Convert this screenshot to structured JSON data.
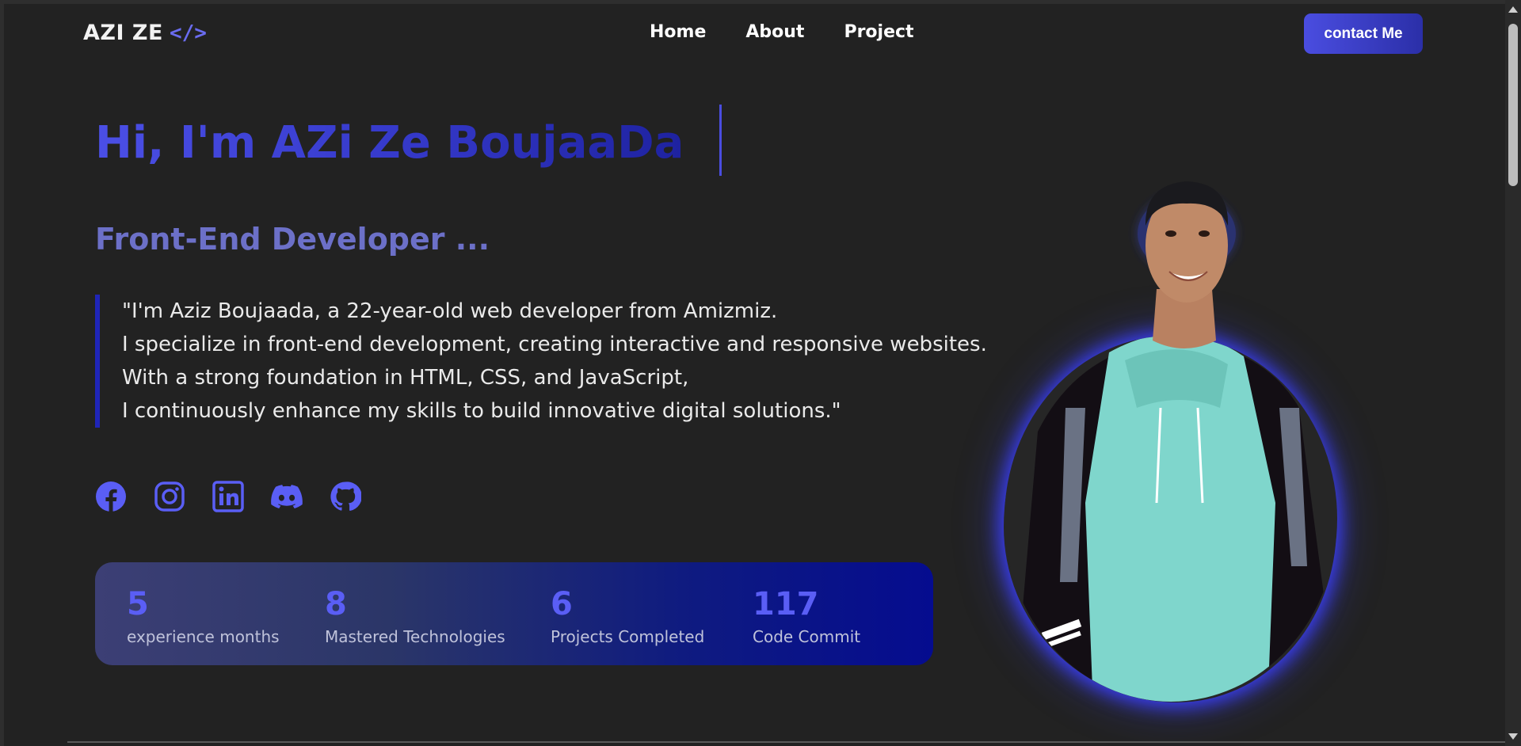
{
  "nav": {
    "logo_text": "AZI ZE",
    "logo_icon": "</>",
    "links": [
      "Home",
      "About",
      "Project"
    ],
    "contact_label": "contact Me"
  },
  "hero": {
    "title": "Hi, I'm AZi Ze BoujaaDa",
    "subtitle": "Front-End Developer ...",
    "bio_lines": [
      "\"I'm Aziz Boujaada, a 22-year-old web developer from Amizmiz.",
      "I specialize in front-end development, creating interactive and responsive websites.",
      "With a strong foundation in HTML, CSS, and JavaScript,",
      "I continuously enhance my skills to build innovative digital solutions.\""
    ]
  },
  "socials": [
    "facebook-icon",
    "instagram-icon",
    "linkedin-icon",
    "discord-icon",
    "github-icon"
  ],
  "stats": [
    {
      "value": "5",
      "label": "experience months"
    },
    {
      "value": "8",
      "label": "Mastered Technologies"
    },
    {
      "value": "6",
      "label": "Projects Completed"
    },
    {
      "value": "117",
      "label": "Code Commit"
    }
  ],
  "colors": {
    "accent": "#4a4de0",
    "background": "#222222",
    "subtitle": "#6c70c8",
    "stat_value": "#5a5ef5"
  }
}
